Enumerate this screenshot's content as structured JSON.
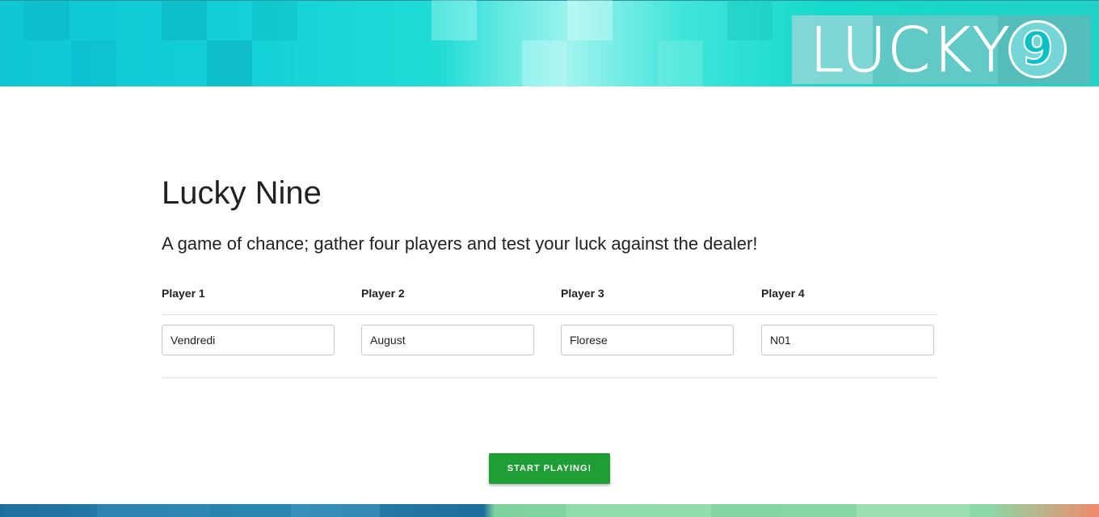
{
  "header": {
    "logo_text": "LUCKY",
    "logo_digit": "9"
  },
  "main": {
    "title": "Lucky Nine",
    "subtitle": "A game of chance; gather four players and test your luck against the dealer!"
  },
  "players": [
    {
      "label": "Player 1",
      "value": "Vendredi"
    },
    {
      "label": "Player 2",
      "value": "August"
    },
    {
      "label": "Player 3",
      "value": "Florese"
    },
    {
      "label": "Player 4",
      "value": "N01"
    }
  ],
  "actions": {
    "start_label": "START PLAYING!"
  },
  "colors": {
    "banner": "#12cfd8",
    "button": "#1e9e35"
  }
}
